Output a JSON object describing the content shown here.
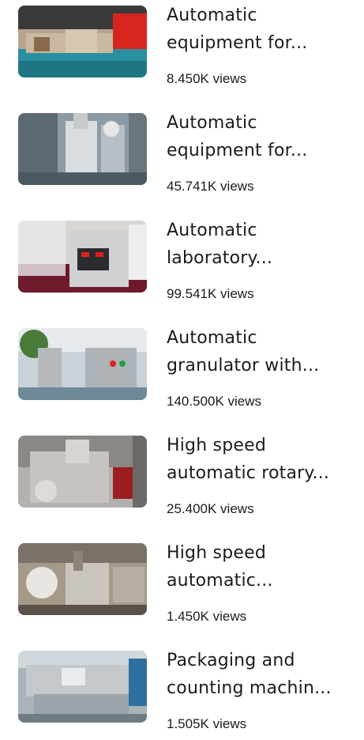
{
  "videos": [
    {
      "line1": "Automatic",
      "line2": "equipment for...",
      "views": "8.450K views"
    },
    {
      "line1": "Automatic",
      "line2": "equipment for...",
      "views": "45.741K views"
    },
    {
      "line1": "Automatic",
      "line2": "laboratory...",
      "views": "99.541K views"
    },
    {
      "line1": "Automatic",
      "line2": "granulator with...",
      "views": "140.500K views"
    },
    {
      "line1": "High speed",
      "line2": "automatic rotary...",
      "views": "25.400K views"
    },
    {
      "line1": "High speed",
      "line2": "automatic...",
      "views": "1.450K views"
    },
    {
      "line1": "Packaging and",
      "line2": "counting machin...",
      "views": "1.505K views"
    }
  ]
}
